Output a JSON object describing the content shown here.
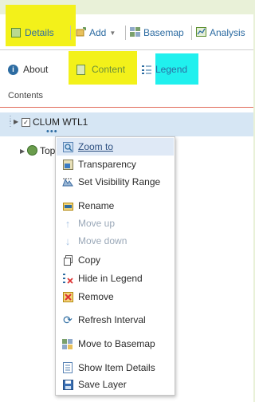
{
  "toolbar": {
    "details_label": "Details",
    "add_label": "Add",
    "basemap_label": "Basemap",
    "analysis_label": "Analysis"
  },
  "tabs": {
    "about_label": "About",
    "content_label": "Content",
    "legend_label": "Legend"
  },
  "contents": {
    "heading": "Contents",
    "layer_name": "CLUM WTL1",
    "second_layer_prefix": "Top"
  },
  "context_menu": {
    "items": [
      {
        "label": "Zoom to",
        "icon": "zoom-icon",
        "enabled": true
      },
      {
        "label": "Transparency",
        "icon": "transparency-icon",
        "enabled": true
      },
      {
        "label": "Set Visibility Range",
        "icon": "visibility-range-icon",
        "enabled": true
      },
      {
        "label": "Rename",
        "icon": "rename-icon",
        "enabled": true
      },
      {
        "label": "Move up",
        "icon": "arrow-up-icon",
        "enabled": false
      },
      {
        "label": "Move down",
        "icon": "arrow-down-icon",
        "enabled": false
      },
      {
        "label": "Copy",
        "icon": "copy-icon",
        "enabled": true
      },
      {
        "label": "Hide in Legend",
        "icon": "hide-legend-icon",
        "enabled": true
      },
      {
        "label": "Remove",
        "icon": "remove-icon",
        "enabled": true
      },
      {
        "label": "Refresh Interval",
        "icon": "refresh-icon",
        "enabled": true
      },
      {
        "label": "Move to Basemap",
        "icon": "move-basemap-icon",
        "enabled": true
      },
      {
        "label": "Show Item Details",
        "icon": "item-details-icon",
        "enabled": true
      },
      {
        "label": "Save Layer",
        "icon": "save-icon",
        "enabled": true
      }
    ]
  },
  "colors": {
    "background": "#e9f1d8",
    "highlight_yellow": "#f3f11a",
    "highlight_cyan": "#20f0ee",
    "layer_row": "#d6e6f4",
    "menu_hover": "#dfe9f6",
    "link": "#2d6ca2"
  }
}
